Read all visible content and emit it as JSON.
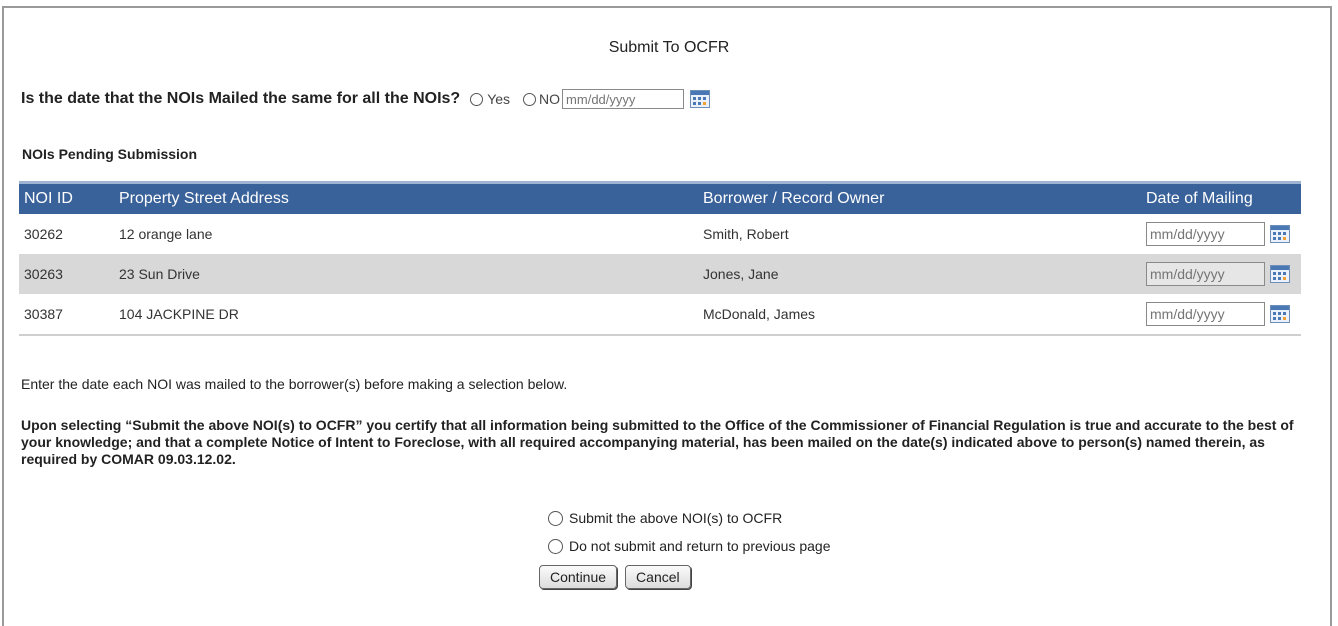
{
  "page": {
    "title": "Submit To OCFR"
  },
  "question": {
    "text": "Is the date that the NOIs Mailed the same for all the NOIs?",
    "yes_label": "Yes",
    "no_label": "NO",
    "date_placeholder": "mm/dd/yyyy"
  },
  "pending": {
    "heading": "NOIs Pending Submission",
    "columns": [
      "NOI ID",
      "Property Street Address",
      "Borrower / Record Owner",
      "Date of Mailing"
    ],
    "rows": [
      {
        "id": "30262",
        "address": "12 orange lane",
        "borrower": "Smith, Robert",
        "date_placeholder": "mm/dd/yyyy"
      },
      {
        "id": "30263",
        "address": "23 Sun Drive",
        "borrower": "Jones, Jane",
        "date_placeholder": "mm/dd/yyyy"
      },
      {
        "id": "30387",
        "address": "104 JACKPINE DR",
        "borrower": "McDonald, James",
        "date_placeholder": "mm/dd/yyyy"
      }
    ]
  },
  "instructions": {
    "note": "Enter the date each NOI was mailed to the borrower(s) before making a selection below.",
    "certification": "Upon selecting “Submit the above NOI(s) to OCFR” you certify that all information being submitted to the Office of the Commissioner of Financial Regulation is true and accurate to the best of your knowledge; and that a complete Notice of Intent to Foreclose, with all required accompanying material, has been mailed on the date(s) indicated above to person(s) named therein, as required by COMAR 09.03.12.02."
  },
  "submission_options": {
    "submit_label": "Submit the above NOI(s) to OCFR",
    "return_label": "Do not submit and return to previous page"
  },
  "buttons": {
    "continue_label": "Continue",
    "cancel_label": "Cancel"
  },
  "colors": {
    "header_bg": "#39619a",
    "alt_row_bg": "#d8d8d8"
  },
  "icons": {
    "calendar": "calendar-icon"
  }
}
